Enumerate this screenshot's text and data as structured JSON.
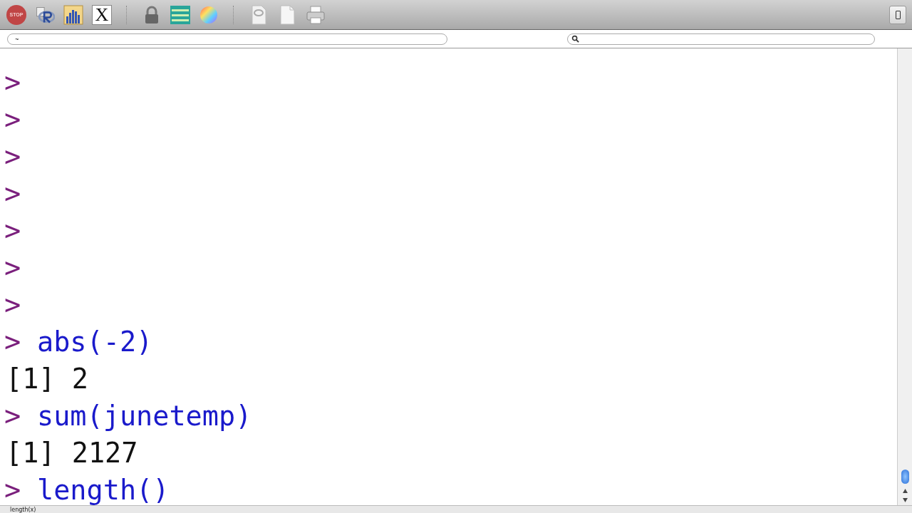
{
  "toolbar": {
    "buttons": [
      {
        "kind": "stop",
        "label": "STOP"
      },
      {
        "kind": "r-source"
      },
      {
        "kind": "chart"
      },
      {
        "kind": "x11",
        "label": "X"
      },
      {
        "kind": "separator"
      },
      {
        "kind": "lock"
      },
      {
        "kind": "data-editor"
      },
      {
        "kind": "color-wheel"
      },
      {
        "kind": "separator"
      },
      {
        "kind": "r-document"
      },
      {
        "kind": "new-document"
      },
      {
        "kind": "print"
      }
    ]
  },
  "path_field": {
    "value": "~"
  },
  "console": {
    "lines": [
      {
        "kind": "prompt"
      },
      {
        "kind": "prompt"
      },
      {
        "kind": "prompt"
      },
      {
        "kind": "prompt"
      },
      {
        "kind": "prompt"
      },
      {
        "kind": "prompt"
      },
      {
        "kind": "prompt"
      },
      {
        "kind": "prompt",
        "text": "abs(-2)"
      },
      {
        "kind": "output",
        "text": "[1] 2"
      },
      {
        "kind": "prompt",
        "text": "sum(junetemp)"
      },
      {
        "kind": "output",
        "text": "[1] 2127"
      },
      {
        "kind": "prompt",
        "text": "length()"
      }
    ],
    "prompt_symbol": ">"
  },
  "status_bar": {
    "text": "length(x)"
  }
}
